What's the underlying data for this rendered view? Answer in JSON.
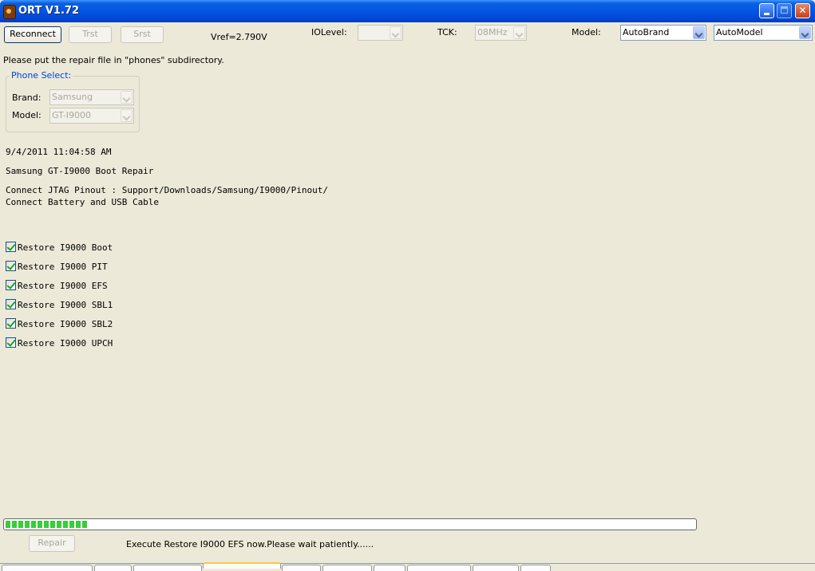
{
  "window": {
    "title": "ORT V1.72"
  },
  "toolbar": {
    "reconnect_label": "Reconnect",
    "trst_label": "Trst",
    "srst_label": "Srst",
    "vref_text": "Vref=2.790V",
    "iolevel_label": "IOLevel:",
    "iolevel_value": "",
    "tck_label": "TCK:",
    "tck_value": "08MHz",
    "model_label": "Model:",
    "brand_combo_value": "AutoBrand",
    "model_combo_value": "AutoModel"
  },
  "info_text": "Please put the repair file in \"phones\" subdirectory.",
  "phone_select": {
    "title": "Phone Select:",
    "brand_label": "Brand:",
    "brand_value": "Samsung",
    "model_label": "Model:",
    "model_value": "GT-I9000"
  },
  "log": {
    "timestamp": "9/4/2011 11:04:58 AM",
    "heading": "Samsung GT-I9000 Boot Repair",
    "line1": "Connect JTAG Pinout : Support/Downloads/Samsung/I9000/Pinout/",
    "line2": "Connect Battery and USB Cable"
  },
  "checkboxes": [
    {
      "label": "Restore I9000 Boot",
      "checked": true
    },
    {
      "label": "Restore I9000 PIT",
      "checked": true
    },
    {
      "label": "Restore I9000 EFS",
      "checked": true
    },
    {
      "label": "Restore I9000 SBL1",
      "checked": true
    },
    {
      "label": "Restore I9000 SBL2",
      "checked": true
    },
    {
      "label": "Restore I9000 UPCH",
      "checked": true
    }
  ],
  "progress": {
    "fraction": 0.12
  },
  "footer": {
    "repair_label": "Repair",
    "status_text": "Execute Restore I9000 EFS now.Please wait patiently......"
  },
  "colors": {
    "titlebar": "#0554e3",
    "window_bg": "#ece9d8",
    "group_title": "#0046d5",
    "progress_fill": "#3ccb3c"
  }
}
